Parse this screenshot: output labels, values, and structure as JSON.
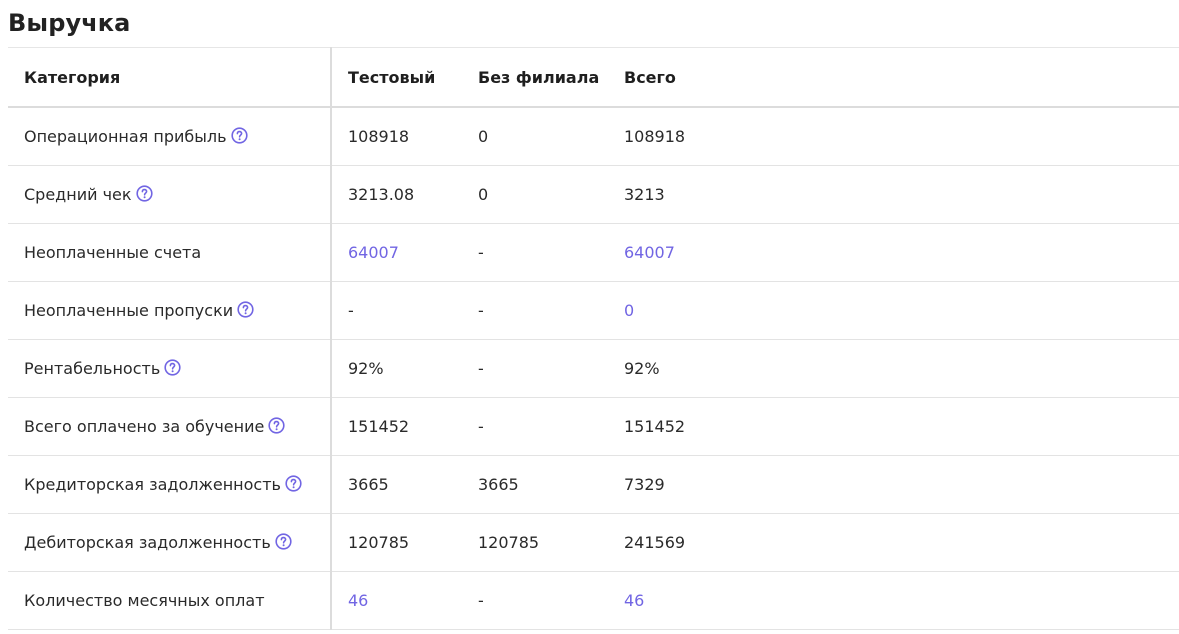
{
  "page": {
    "title": "Выручка"
  },
  "colors": {
    "link": "#7165e3",
    "help_icon": "#7165e3"
  },
  "table": {
    "headers": [
      "Категория",
      "Тестовый",
      "Без филиала",
      "Всего"
    ],
    "rows": [
      {
        "category": "Операционная прибыль",
        "help": true,
        "test": "108918",
        "no_branch": "0",
        "total": "108918",
        "links": []
      },
      {
        "category": "Средний чек",
        "help": true,
        "test": "3213.08",
        "no_branch": "0",
        "total": "3213",
        "links": []
      },
      {
        "category": "Неоплаченные счета",
        "help": false,
        "test": "64007",
        "no_branch": "-",
        "total": "64007",
        "links": [
          "test",
          "total"
        ]
      },
      {
        "category": "Неоплаченные пропуски",
        "help": true,
        "test": "-",
        "no_branch": "-",
        "total": "0",
        "links": [
          "total"
        ]
      },
      {
        "category": "Рентабельность",
        "help": true,
        "test": "92%",
        "no_branch": "-",
        "total": "92%",
        "links": []
      },
      {
        "category": "Всего оплачено за обучение",
        "help": true,
        "test": "151452",
        "no_branch": "-",
        "total": "151452",
        "links": []
      },
      {
        "category": "Кредиторская задолженность",
        "help": true,
        "test": "3665",
        "no_branch": "3665",
        "total": "7329",
        "links": []
      },
      {
        "category": "Дебиторская задолженность",
        "help": true,
        "test": "120785",
        "no_branch": "120785",
        "total": "241569",
        "links": []
      },
      {
        "category": "Количество месячных оплат",
        "help": false,
        "test": "46",
        "no_branch": "-",
        "total": "46",
        "links": [
          "test",
          "total"
        ]
      }
    ]
  }
}
